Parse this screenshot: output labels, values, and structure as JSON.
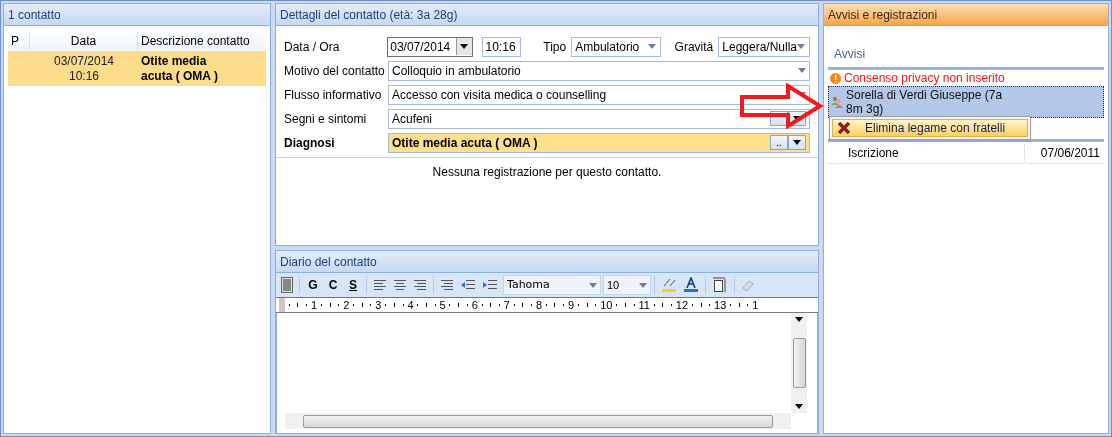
{
  "contacts_panel": {
    "title": "1 contatto",
    "columns": [
      "P",
      "Data",
      "Descrizione contatto"
    ],
    "rows": [
      {
        "date": "03/07/2014 10:16",
        "description": "Otite media acuta ( OMA )",
        "selected": true
      }
    ]
  },
  "details_panel": {
    "title": "Dettagli del contatto (età: 3a 28g)",
    "date_row": {
      "label": "Data / Ora",
      "date": "03/07/2014",
      "time": "10:16",
      "type_label": "Tipo",
      "type_value": "Ambulatorio",
      "severity_label": "Gravità",
      "severity_value": "Leggera/Nulla"
    },
    "fields": [
      {
        "kind": "select",
        "label": "Motivo del contatto",
        "value": "Colloquio in ambulatorio",
        "highlighted": false
      },
      {
        "kind": "select",
        "label": "Flusso informativo",
        "value": "Accesso con visita medica o counselling",
        "highlighted": false
      },
      {
        "kind": "lookup",
        "label": "Segni e sintomi",
        "value": "Acufeni",
        "highlighted": false
      },
      {
        "kind": "lookup",
        "label": "Diagnosi",
        "value": "Otite media acuta ( OMA )",
        "button_label": "..",
        "highlighted": true
      }
    ],
    "empty_message": "Nessuna registrazione per questo contatto."
  },
  "diary_panel": {
    "title": "Diario del contatto",
    "toolbar": {
      "bold": "G",
      "italic": "C",
      "underline": "S",
      "font": "Tahoma",
      "size": "10"
    },
    "ruler": [
      "1",
      "2",
      "3",
      "4",
      "5",
      "6",
      "7",
      "8",
      "9",
      "10",
      "11",
      "12",
      "13",
      "1"
    ]
  },
  "notices_panel": {
    "title": "Avvisi e registrazioni",
    "section": "Avvisi",
    "items": [
      {
        "kind": "warning",
        "text": "Consenso privacy non inserito",
        "selected": false
      },
      {
        "kind": "relative",
        "text": "Sorella di Verdi Giuseppe (7a 8m 3g)",
        "selected": true
      }
    ],
    "context_menu": [
      "Elimina legame con fratelli"
    ],
    "registrations": [
      {
        "label": "Iscrizione",
        "date": "07/06/2011"
      }
    ]
  }
}
